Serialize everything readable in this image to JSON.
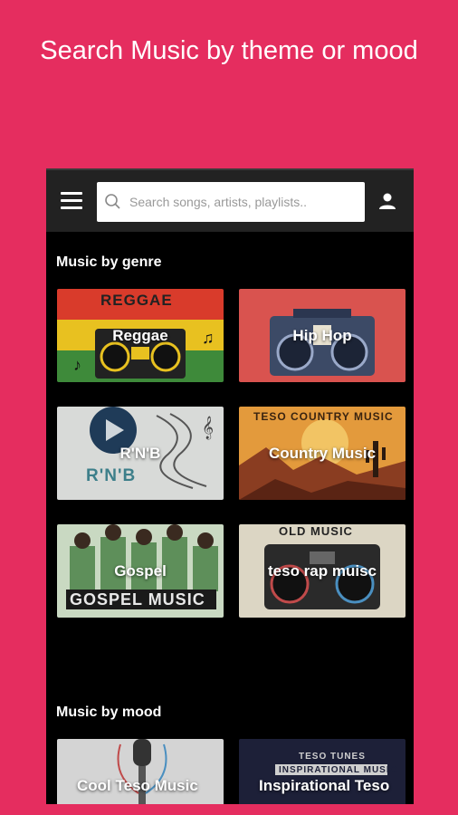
{
  "headline": "Search Music by theme or mood",
  "search": {
    "placeholder": "Search songs, artists, playlists.."
  },
  "sections": {
    "genre_title": "Music by genre",
    "mood_title": "Music by mood"
  },
  "genres": [
    {
      "label": "Reggae",
      "banner": "REGGAE"
    },
    {
      "label": "Hip Hop",
      "banner": ""
    },
    {
      "label": "R'N'B",
      "banner": "R'N'B"
    },
    {
      "label": "Country Music",
      "banner": "TESO COUNTRY MUSIC"
    },
    {
      "label": "Gospel",
      "banner": "GOSPEL MUSIC"
    },
    {
      "label": "teso rap muisc",
      "banner": "OLD MUSIC"
    }
  ],
  "moods": [
    {
      "label": "Cool Teso Music",
      "banner": ""
    },
    {
      "label": "Inspirational Teso",
      "banner": "TESO TUNES",
      "banner2": "INSPIRATIONAL MUSIC"
    }
  ],
  "colors": {
    "background": "#e52d5f",
    "appbar": "#222222",
    "content": "#000000"
  },
  "icons": {
    "menu": "hamburger-menu-icon",
    "search": "search-icon",
    "user": "user-account-icon"
  }
}
